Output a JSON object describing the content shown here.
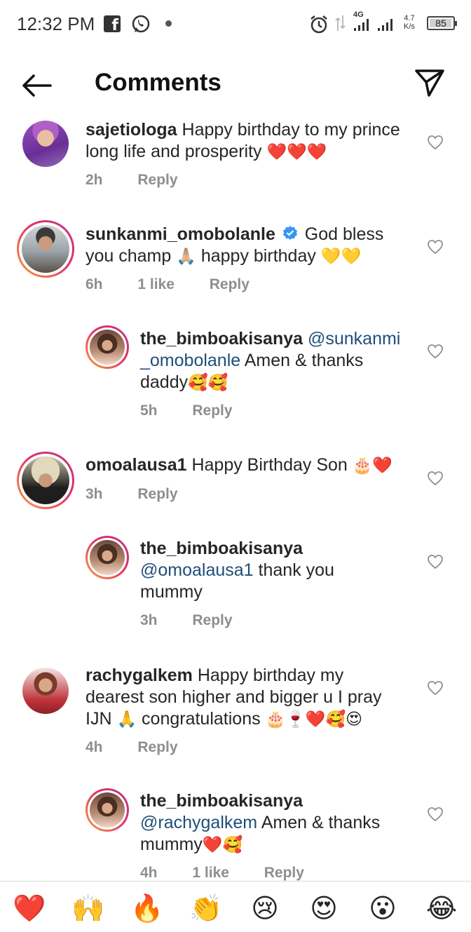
{
  "status_bar": {
    "time": "12:32 PM",
    "network": "4G",
    "speed_value": "4.7",
    "speed_unit": "K/s",
    "battery": "85"
  },
  "header": {
    "title": "Comments"
  },
  "comments": [
    {
      "username": "sajetiologa",
      "text": "Happy birthday to my prince",
      "text2": "long life and prosperity",
      "emoji": "❤️❤️❤️",
      "time": "2h",
      "reply": "Reply"
    },
    {
      "username": "sunkanmi_omobolanle",
      "verified": true,
      "text": "God bless",
      "text2": "you champ",
      "emoji_a": "🙏🏼",
      "text3": "happy birthday",
      "emoji_b": "💛💛",
      "time": "6h",
      "likes": "1 like",
      "reply": "Reply"
    },
    {
      "username": "the_bimboakisanya",
      "mention": "@sunkanmi",
      "mention2": "_omobolanle",
      "text": "Amen & thanks",
      "text2": "daddy",
      "emoji": "🥰🥰",
      "time": "5h",
      "reply": "Reply"
    },
    {
      "username": "omoalausa1",
      "text": "Happy Birthday Son",
      "emoji": "🎂❤️",
      "time": "3h",
      "reply": "Reply"
    },
    {
      "username": "the_bimboakisanya",
      "mention": "@omoalausa1",
      "text": "thank you",
      "text2": "mummy",
      "time": "3h",
      "reply": "Reply"
    },
    {
      "username": "rachygalkem",
      "text": "Happy birthday my",
      "text2": "dearest son higher and bigger u I pray",
      "text3": "IJN",
      "emoji_a": "🙏",
      "text4": "congratulations",
      "emoji_b": "🎂🍷❤️🥰😍",
      "time": "4h",
      "reply": "Reply"
    },
    {
      "username": "the_bimboakisanya",
      "mention": "@rachygalkem",
      "text": "Amen & thanks",
      "text2": "mummy",
      "emoji": "❤️🥰",
      "time": "4h",
      "likes": "1 like",
      "reply": "Reply"
    }
  ],
  "reactions": [
    "❤️",
    "🙌",
    "🔥",
    "👏",
    "😢",
    "😍",
    "😮",
    "😂"
  ],
  "colors": {
    "link": "#1f4e79",
    "meta": "#8e8e8e",
    "verified": "#3897f0"
  }
}
